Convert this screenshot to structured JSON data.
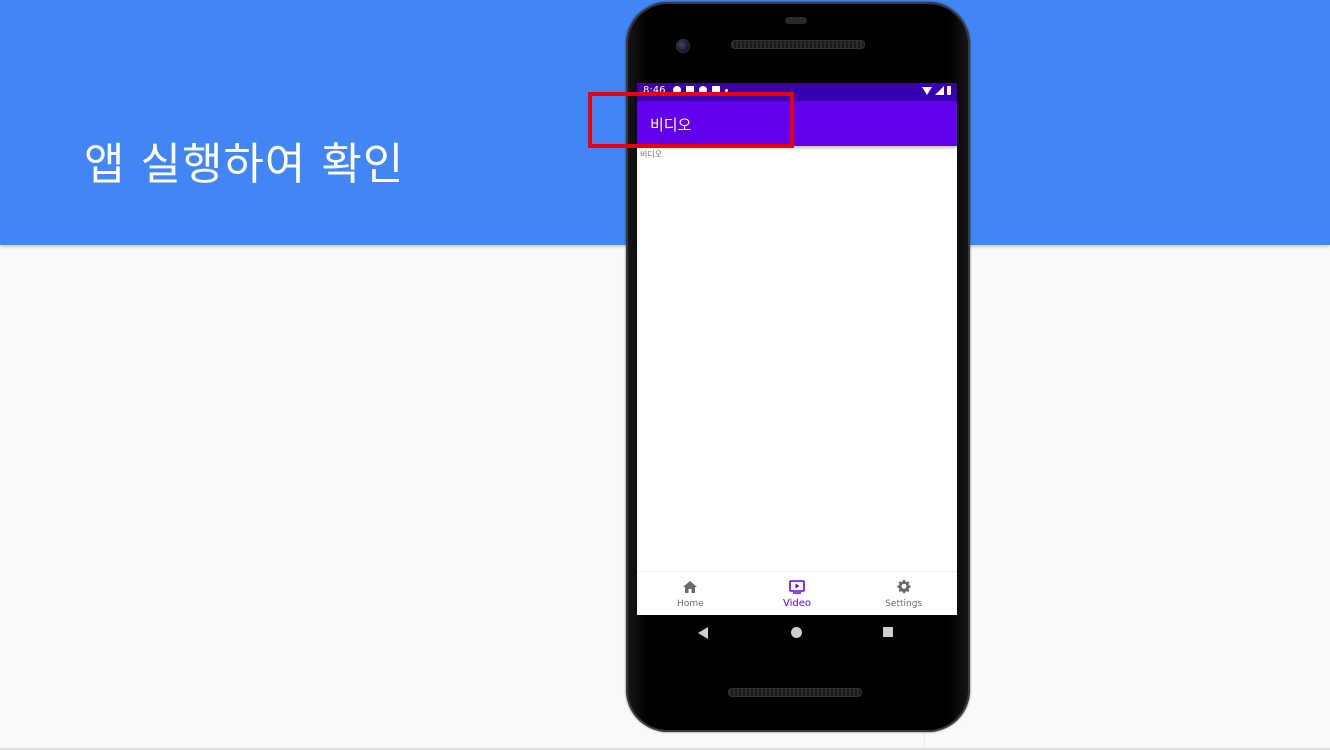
{
  "slide": {
    "title": "앱 실행하여 확인"
  },
  "colors": {
    "band": "#4285f4",
    "status_bar": "#3700b3",
    "app_bar": "#6200ee",
    "highlight": "#e8000b",
    "nav_active": "#6200ee"
  },
  "phone": {
    "status_bar": {
      "time": "8:46"
    },
    "app_bar": {
      "title": "비디오"
    },
    "content": {
      "text": "비디오"
    },
    "bottom_nav": {
      "items": [
        {
          "label": "Home",
          "icon": "home-icon",
          "active": false
        },
        {
          "label": "Video",
          "icon": "video-icon",
          "active": true
        },
        {
          "label": "Settings",
          "icon": "gear-icon",
          "active": false
        }
      ]
    },
    "system_nav": {
      "buttons": [
        "back-icon",
        "home-circle-icon",
        "recents-icon"
      ]
    }
  }
}
